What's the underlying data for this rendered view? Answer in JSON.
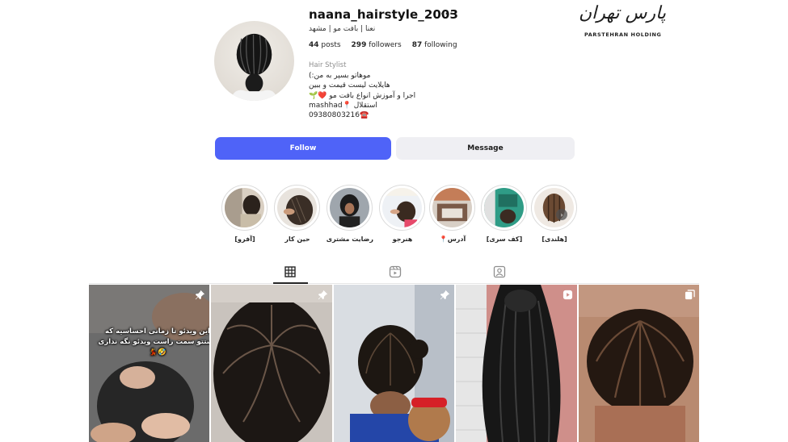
{
  "profile": {
    "username": "naana_hairstyle_2003",
    "more": "···",
    "subtitle": "نعنا | بافت مو | مشهد",
    "stats": {
      "posts_count": "44",
      "posts_label": "posts",
      "followers_count": "299",
      "followers_label": "followers",
      "following_count": "87",
      "following_label": "following"
    },
    "category": "Hair Stylist",
    "bio": [
      "موهاتو بسپر به من:)",
      "هایلایت لیست قیمت و ببین",
      "اجرا و آموزش انواع بافت مو ❤️🌱",
      "mashhad📍 استقلال",
      "09380803216☎️"
    ]
  },
  "watermark": {
    "logo_text": "پارس تهران",
    "logo_subtext": "PARSTEHRAN HOLDING"
  },
  "buttons": {
    "follow": "Follow",
    "message": "Message"
  },
  "highlights": [
    {
      "label": "[آفرو]",
      "icon": "highlight-afro"
    },
    {
      "label": "حین کار",
      "icon": "highlight-working"
    },
    {
      "label": "رضایت مشتری",
      "icon": "highlight-customer"
    },
    {
      "label": "هنرجو",
      "icon": "highlight-student"
    },
    {
      "label": "آدرس📍",
      "icon": "highlight-address"
    },
    {
      "label": "[کف سری]",
      "icon": "highlight-scalp"
    },
    {
      "label": "[هلندی]",
      "icon": "highlight-dutch"
    }
  ],
  "tabs": [
    {
      "name": "posts",
      "icon": "grid-icon",
      "active": true
    },
    {
      "name": "reels",
      "icon": "reels-icon",
      "active": false
    },
    {
      "name": "tagged",
      "icon": "tagged-icon",
      "active": false
    }
  ],
  "posts": [
    {
      "badge": "pin-icon",
      "overlay": "این ویدئو تا زمانی احساسیه که دستتو سمت راست ویدئو نگه نداری 🤣💃"
    },
    {
      "badge": "pin-icon",
      "overlay": ""
    },
    {
      "badge": "pin-icon",
      "overlay": ""
    },
    {
      "badge": "reel-icon",
      "overlay": ""
    },
    {
      "badge": "carousel-icon",
      "overlay": ""
    }
  ],
  "colors": {
    "follow_button": "#4f63f8",
    "message_button": "#efeff3"
  }
}
